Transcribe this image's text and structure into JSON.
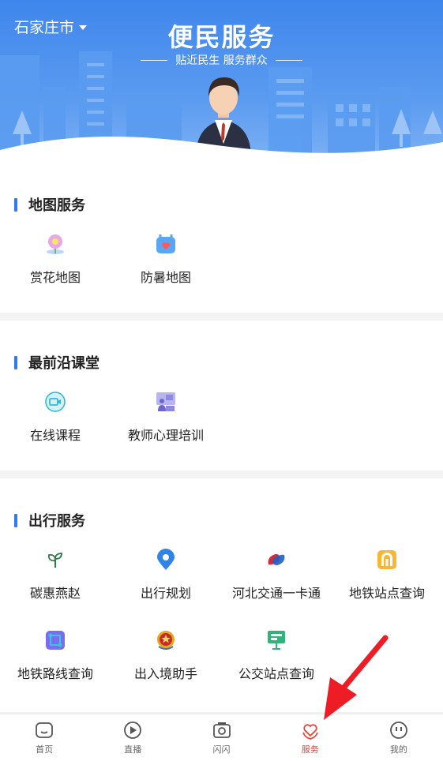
{
  "header": {
    "city": "石家庄市",
    "banner_title": "便民服务",
    "banner_subtitle": "贴近民生 服务群众"
  },
  "sections": [
    {
      "title": "地图服务",
      "items": [
        {
          "label": "赏花地图",
          "icon": "flower-map-icon"
        },
        {
          "label": "防暑地图",
          "icon": "heat-map-icon"
        }
      ]
    },
    {
      "title": "最前沿课堂",
      "items": [
        {
          "label": "在线课程",
          "icon": "video-camera-icon"
        },
        {
          "label": "教师心理培训",
          "icon": "teacher-board-icon"
        }
      ]
    },
    {
      "title": "出行服务",
      "items": [
        {
          "label": "碳惠燕赵",
          "icon": "sprout-icon"
        },
        {
          "label": "出行规划",
          "icon": "location-pin-icon"
        },
        {
          "label": "河北交通一卡通",
          "icon": "transit-card-icon"
        },
        {
          "label": "地铁站点查询",
          "icon": "metro-station-icon"
        },
        {
          "label": "地铁路线查询",
          "icon": "metro-route-icon"
        },
        {
          "label": "出入境助手",
          "icon": "police-badge-icon"
        },
        {
          "label": "公交站点查询",
          "icon": "bus-stop-icon"
        }
      ]
    }
  ],
  "tabbar": [
    {
      "label": "首页",
      "icon": "home-icon"
    },
    {
      "label": "直播",
      "icon": "play-icon"
    },
    {
      "label": "闪闪",
      "icon": "camera-icon"
    },
    {
      "label": "服务",
      "icon": "heart-hands-icon",
      "active": true
    },
    {
      "label": "我的",
      "icon": "face-icon"
    }
  ],
  "colors": {
    "accent_blue": "#2f7cf0",
    "active_red": "#e8453c",
    "banner_blue": "#3f86ec"
  }
}
